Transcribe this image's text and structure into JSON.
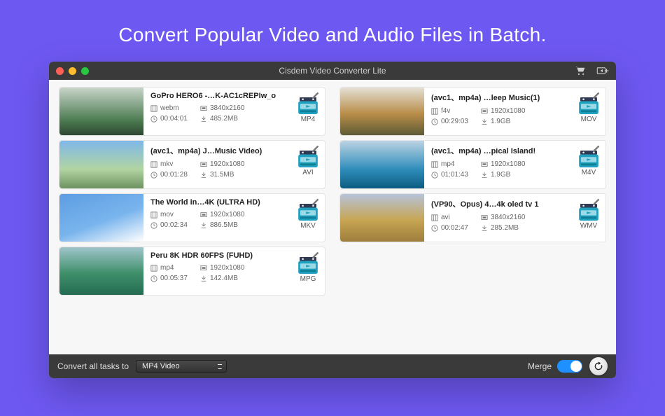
{
  "headline": "Convert Popular Video and Audio Files in Batch.",
  "window": {
    "title": "Cisdem Video Converter Lite"
  },
  "footer": {
    "convert_label": "Convert all tasks to",
    "format_selected": "MP4 Video",
    "merge_label": "Merge",
    "merge_on": true
  },
  "files": [
    {
      "title": "GoPro HERO6 -…K-AC1cREPIw_o",
      "container": "webm",
      "resolution": "3840x2160",
      "duration": "00:04:01",
      "size": "485.2MB",
      "target": "MP4",
      "thumb": "th-mountain"
    },
    {
      "title": "(avc1、mp4a) J…Music Video)",
      "container": "mkv",
      "resolution": "1920x1080",
      "duration": "00:01:28",
      "size": "31.5MB",
      "target": "AVI",
      "thumb": "th-palms"
    },
    {
      "title": "The World in…4K (ULTRA HD)",
      "container": "mov",
      "resolution": "1920x1080",
      "duration": "00:02:34",
      "size": "886.5MB",
      "target": "MKV",
      "thumb": "th-sky"
    },
    {
      "title": "Peru 8K HDR 60FPS (FUHD)",
      "container": "mp4",
      "resolution": "1920x1080",
      "duration": "00:05:37",
      "size": "142.4MB",
      "target": "MPG",
      "thumb": "th-peru"
    },
    {
      "title": "(avc1、mp4a) …leep Music(1)",
      "container": "f4v",
      "resolution": "1920x1080",
      "duration": "00:29:03",
      "size": "1.9GB",
      "target": "MOV",
      "thumb": "th-hills"
    },
    {
      "title": "(avc1、mp4a) …pical Island!",
      "container": "mp4",
      "resolution": "1920x1080",
      "duration": "01:01:43",
      "size": "1.9GB",
      "target": "M4V",
      "thumb": "th-sea"
    },
    {
      "title": "(VP90、Opus) 4…4k oled tv 1",
      "container": "avi",
      "resolution": "3840x2160",
      "duration": "00:02:47",
      "size": "285.2MB",
      "target": "WMV",
      "thumb": "th-savanna"
    }
  ]
}
